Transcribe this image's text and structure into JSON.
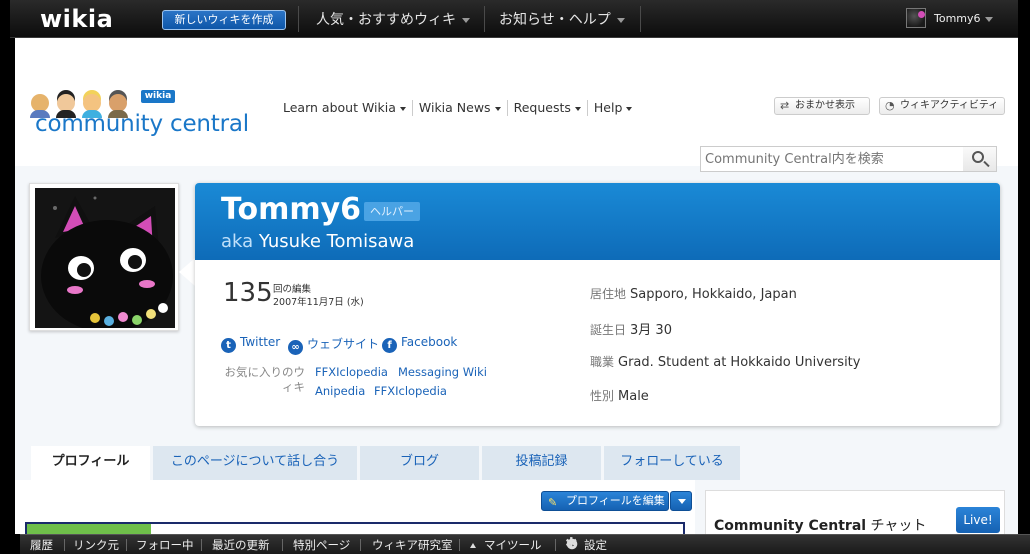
{
  "global_nav": {
    "logo_text": "wikia",
    "create_wiki_label": "新しいウィキを作成",
    "menus": [
      "人気・おすすめウィキ",
      "お知らせ・ヘルプ"
    ],
    "user_name": "Tommy6"
  },
  "wiki_header": {
    "logo_tag": "wikia",
    "wordmark": "community central",
    "nav_items": [
      "Learn about Wikia",
      "Wikia News",
      "Requests",
      "Help"
    ],
    "random_button": "おまかせ表示",
    "activity_button": "ウィキアクティビティ",
    "search_placeholder": "Community Central内を検索"
  },
  "masthead": {
    "user_title": "Tommy6",
    "badge": "ヘルパー",
    "aka_prefix": "aka",
    "real_name": "Yusuke Tomisawa",
    "edit_count": "135",
    "edit_label": "回の編集",
    "edit_since": "2007年11月7日 (水)",
    "social": {
      "twitter": "Twitter",
      "website": "ウェブサイト",
      "facebook": "Facebook"
    },
    "fav_label": "お気に入りのウィキ",
    "fav_wikis": [
      "FFXIclopedia",
      "Messaging Wiki",
      "Anipedia",
      "FFXIclopedia"
    ],
    "info": [
      {
        "key": "居住地",
        "value": "Sapporo, Hokkaido, Japan"
      },
      {
        "key": "誕生日",
        "value": "3月 30"
      },
      {
        "key": "職業",
        "value": "Grad. Student at Hokkaido University"
      },
      {
        "key": "性別",
        "value": "Male"
      }
    ]
  },
  "tabs": [
    "プロフィール",
    "このページについて話し合う",
    "ブログ",
    "投稿記録",
    "フォローしている"
  ],
  "content": {
    "edit_profile_label": "プロフィールを編集",
    "chat_title_bold": "Community Central",
    "chat_title_suffix": " チャット",
    "live_label": "Live!"
  },
  "toolbar": {
    "items": [
      "履歴",
      "リンク元",
      "フォロー中",
      "最近の更新",
      "特別ページ",
      "ウィキア研究室"
    ],
    "my_tools": "マイツール",
    "settings": "設定"
  },
  "colors": {
    "brand_blue": "#1a77c8",
    "masthead_blue": "#1a8ad6",
    "link_blue": "#1a63b8"
  }
}
